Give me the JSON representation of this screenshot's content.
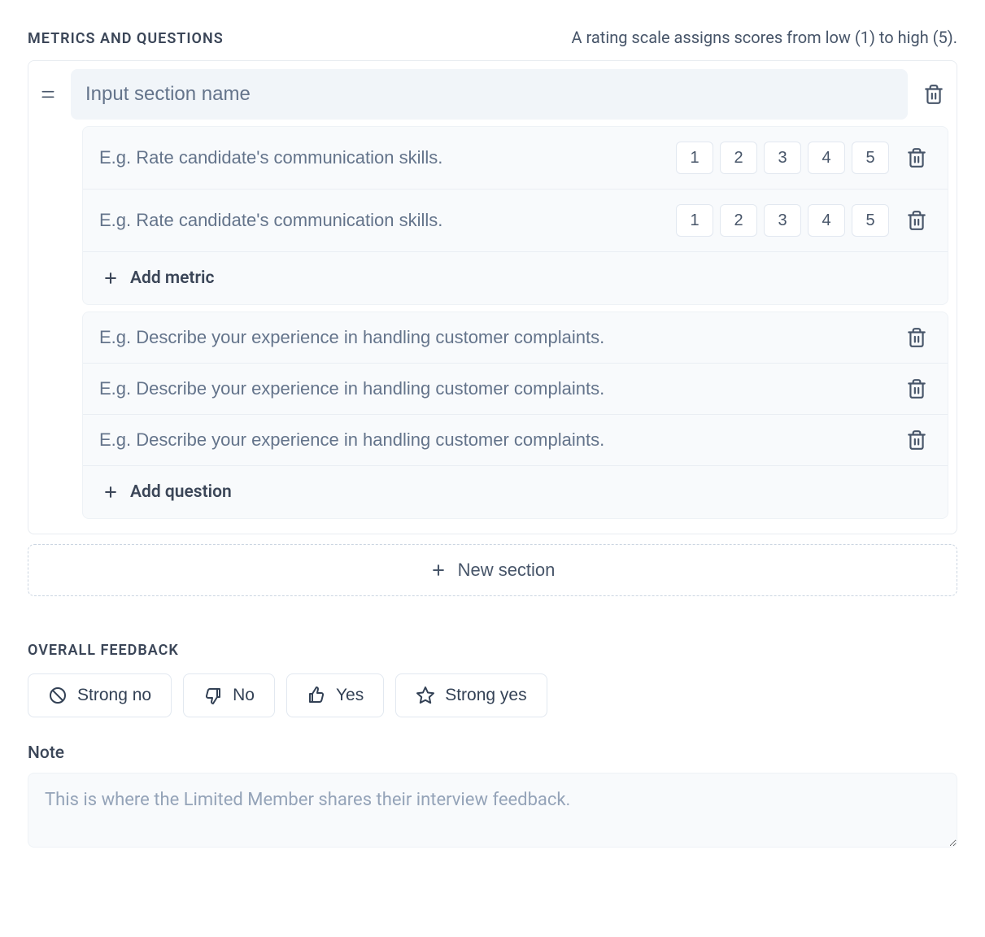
{
  "metrics": {
    "title": "METRICS AND QUESTIONS",
    "subtext": "A rating scale assigns scores from low (1) to high (5).",
    "section_name_placeholder": "Input section name",
    "metric_placeholder": "E.g. Rate candidate's communication skills.",
    "question_placeholder": "E.g. Describe your experience in handling customer complaints.",
    "ratings": [
      "1",
      "2",
      "3",
      "4",
      "5"
    ],
    "add_metric_label": "Add metric",
    "add_question_label": "Add question",
    "new_section_label": "New section"
  },
  "overall": {
    "title": "OVERALL FEEDBACK",
    "options": {
      "strong_no": "Strong no",
      "no": "No",
      "yes": "Yes",
      "strong_yes": "Strong yes"
    }
  },
  "note": {
    "label": "Note",
    "placeholder": "This is where the Limited Member shares their interview feedback."
  }
}
